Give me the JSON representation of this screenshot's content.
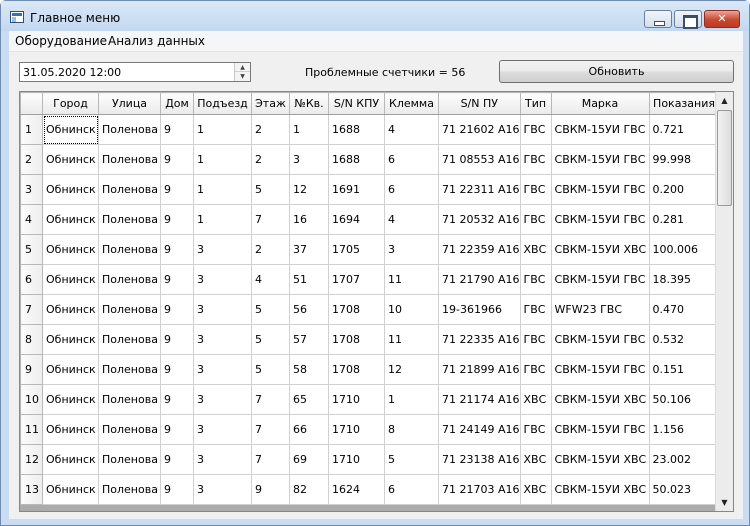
{
  "window": {
    "title": "Главное меню"
  },
  "menu": {
    "items": [
      "Оборудование",
      "Анализ данных"
    ]
  },
  "toolbar": {
    "date_value": "31.05.2020 12:00",
    "status_text": "Проблемные счетчики = 56",
    "refresh_label": "Обновить"
  },
  "grid": {
    "columns": [
      "Город",
      "Улица",
      "Дом",
      "Подъезд",
      "Этаж",
      "№Кв.",
      "S/N КПУ",
      "Клемма",
      "S/N ПУ",
      "Тип",
      "Марка",
      "Показания"
    ],
    "rows": [
      [
        "1",
        "Обнинск",
        "Поленова",
        "9",
        "1",
        "2",
        "1",
        "1688",
        "4",
        "71 21602 А16",
        "ГВС",
        "СВКМ-15УИ ГВС",
        "0.721"
      ],
      [
        "2",
        "Обнинск",
        "Поленова",
        "9",
        "1",
        "2",
        "3",
        "1688",
        "6",
        "71 08553 А16",
        "ГВС",
        "СВКМ-15УИ ГВС",
        "99.998"
      ],
      [
        "3",
        "Обнинск",
        "Поленова",
        "9",
        "1",
        "5",
        "12",
        "1691",
        "6",
        "71 22311 А16",
        "ГВС",
        "СВКМ-15УИ ГВС",
        "0.200"
      ],
      [
        "4",
        "Обнинск",
        "Поленова",
        "9",
        "1",
        "7",
        "16",
        "1694",
        "4",
        "71 20532 А16",
        "ГВС",
        "СВКМ-15УИ ГВС",
        "0.281"
      ],
      [
        "5",
        "Обнинск",
        "Поленова",
        "9",
        "3",
        "2",
        "37",
        "1705",
        "3",
        "71 22359 А16",
        "ХВС",
        "СВКМ-15УИ ХВС",
        "100.006"
      ],
      [
        "6",
        "Обнинск",
        "Поленова",
        "9",
        "3",
        "4",
        "51",
        "1707",
        "11",
        "71 21790 А16",
        "ГВС",
        "СВКМ-15УИ ГВС",
        "18.395"
      ],
      [
        "7",
        "Обнинск",
        "Поленова",
        "9",
        "3",
        "5",
        "56",
        "1708",
        "10",
        "19-361966",
        "ГВС",
        "WFW23 ГВС",
        "0.470"
      ],
      [
        "8",
        "Обнинск",
        "Поленова",
        "9",
        "3",
        "5",
        "57",
        "1708",
        "11",
        "71 22335 А16",
        "ГВС",
        "СВКМ-15УИ ГВС",
        "0.532"
      ],
      [
        "9",
        "Обнинск",
        "Поленова",
        "9",
        "3",
        "5",
        "58",
        "1708",
        "12",
        "71 21899 А16",
        "ГВС",
        "СВКМ-15УИ ГВС",
        "0.151"
      ],
      [
        "10",
        "Обнинск",
        "Поленова",
        "9",
        "3",
        "7",
        "65",
        "1710",
        "1",
        "71 21174 А16",
        "ХВС",
        "СВКМ-15УИ ХВС",
        "50.106"
      ],
      [
        "11",
        "Обнинск",
        "Поленова",
        "9",
        "3",
        "7",
        "66",
        "1710",
        "8",
        "71 24149 А16",
        "ГВС",
        "СВКМ-15УИ ГВС",
        "1.156"
      ],
      [
        "12",
        "Обнинск",
        "Поленова",
        "9",
        "3",
        "7",
        "69",
        "1710",
        "5",
        "71 23138 А16",
        "ХВС",
        "СВКМ-15УИ ХВС",
        "23.002"
      ],
      [
        "13",
        "Обнинск",
        "Поленова",
        "9",
        "3",
        "9",
        "82",
        "1624",
        "6",
        "71 21703 А16",
        "ХВС",
        "СВКМ-15УИ ХВС",
        "50.023"
      ]
    ]
  },
  "icons": {
    "app": "app-window-icon",
    "minimize": "minimize-icon",
    "maximize": "maximize-icon",
    "close": "close-icon",
    "spin_up": "spin-up-icon",
    "spin_down": "spin-down-icon",
    "scroll_up": "scroll-up-icon",
    "scroll_down": "scroll-down-icon"
  },
  "colors": {
    "titlebar": "#c2d8f0",
    "close_button": "#c8492f",
    "background": "#f0f0f0"
  }
}
